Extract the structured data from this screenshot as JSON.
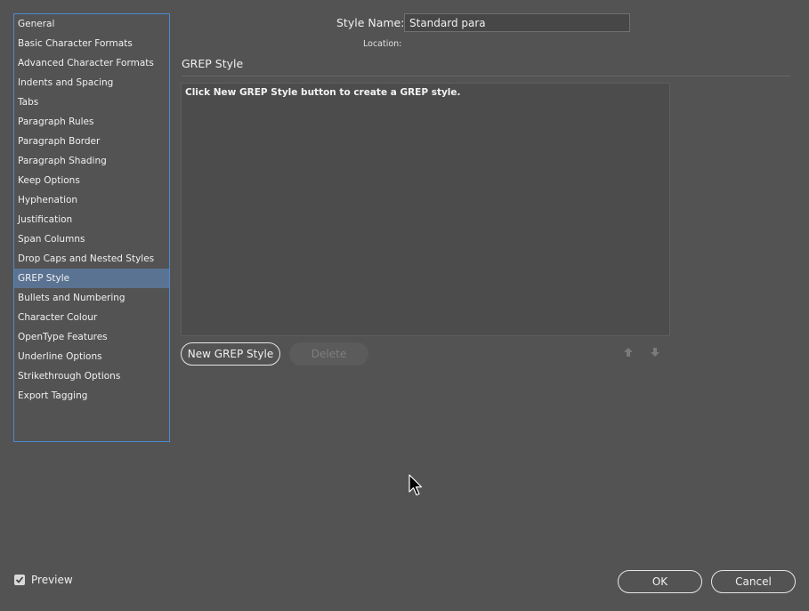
{
  "sidebar": {
    "items": [
      {
        "label": "General"
      },
      {
        "label": "Basic Character Formats"
      },
      {
        "label": "Advanced Character Formats"
      },
      {
        "label": "Indents and Spacing"
      },
      {
        "label": "Tabs"
      },
      {
        "label": "Paragraph Rules"
      },
      {
        "label": "Paragraph Border"
      },
      {
        "label": "Paragraph Shading"
      },
      {
        "label": "Keep Options"
      },
      {
        "label": "Hyphenation"
      },
      {
        "label": "Justification"
      },
      {
        "label": "Span Columns"
      },
      {
        "label": "Drop Caps and Nested Styles"
      },
      {
        "label": "GREP Style"
      },
      {
        "label": "Bullets and Numbering"
      },
      {
        "label": "Character Colour"
      },
      {
        "label": "OpenType Features"
      },
      {
        "label": "Underline Options"
      },
      {
        "label": "Strikethrough Options"
      },
      {
        "label": "Export Tagging"
      }
    ],
    "selected_label": "GREP Style"
  },
  "style_name": {
    "label": "Style Name:",
    "value": "Standard para"
  },
  "location": {
    "label": "Location:"
  },
  "section": {
    "title": "GREP Style",
    "hint": "Click New GREP Style button to create a GREP style."
  },
  "buttons": {
    "new_grep_style": "New GREP Style",
    "delete": "Delete",
    "ok": "OK",
    "cancel": "Cancel"
  },
  "preview": {
    "label": "Preview",
    "checked": true
  },
  "colors": {
    "background": "#535353",
    "selection": "#5b7392",
    "focus_border": "#4a8ad0"
  }
}
